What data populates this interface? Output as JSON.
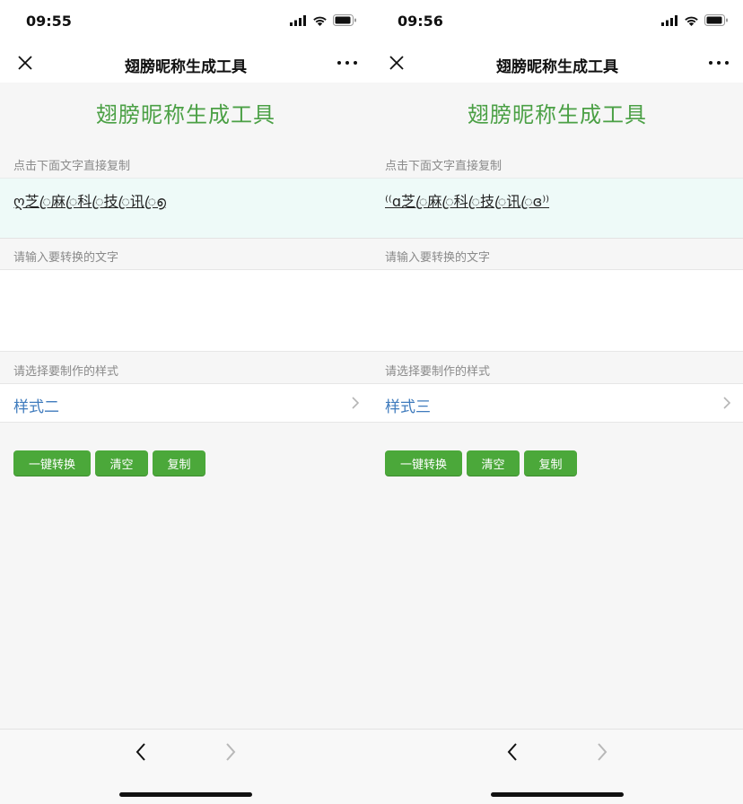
{
  "screens": [
    {
      "status": {
        "time": "09:55"
      },
      "nav": {
        "title": "翅膀昵称生成工具"
      },
      "page_title": "翅膀昵称生成工具",
      "output": {
        "label": "点击下面文字直接复制",
        "text": "ღ芝ꦿ麻ꦿ科ꦿ技ꦿ讯ꦿ൭"
      },
      "input": {
        "label": "请输入要转换的文字",
        "value": ""
      },
      "style_select": {
        "label": "请选择要制作的样式",
        "value": "样式二"
      },
      "buttons": {
        "convert": "一键转换",
        "clear": "清空",
        "copy": "复制"
      }
    },
    {
      "status": {
        "time": "09:56"
      },
      "nav": {
        "title": "翅膀昵称生成工具"
      },
      "page_title": "翅膀昵称生成工具",
      "output": {
        "label": "点击下面文字直接复制",
        "text": "⁽⁽ɑ芝ꦿ麻ꦿ科ꦿ技ꦿ讯ꦿɞ⁾⁾"
      },
      "input": {
        "label": "请输入要转换的文字",
        "value": ""
      },
      "style_select": {
        "label": "请选择要制作的样式",
        "value": "样式三"
      },
      "buttons": {
        "convert": "一键转换",
        "clear": "清空",
        "copy": "复制"
      }
    }
  ],
  "colors": {
    "accent_green": "#4ba045",
    "button_green": "#4ba83a",
    "link_blue": "#3f7bbd",
    "output_bg": "#eefaf8"
  },
  "icons": [
    "signal-icon",
    "wifi-icon",
    "battery-icon",
    "close-icon",
    "more-icon",
    "chevron-right-icon",
    "back-icon",
    "forward-icon"
  ]
}
